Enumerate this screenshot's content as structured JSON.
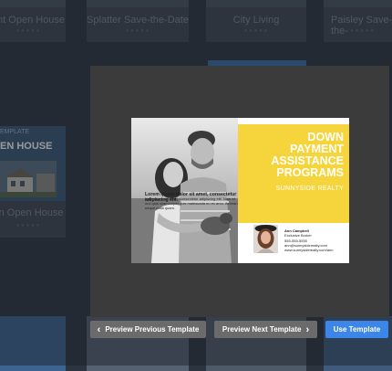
{
  "gallery": {
    "top_row": [
      {
        "title": "ant Open House",
        "stars": "★★★★★"
      },
      {
        "title": "Splatter Save-the-Date",
        "stars": "★★★★★"
      },
      {
        "title": "City Living",
        "stars": "★★★★★"
      },
      {
        "title": "Paisley Save-the-",
        "stars": "★★★★★"
      }
    ],
    "middle_card": {
      "badge": "EMPLATE",
      "overlay_text": "EN HOUSE",
      "title": "an Open House",
      "stars": "★★★★★"
    }
  },
  "preview": {
    "headline_lines": [
      "DOWN",
      "PAYMENT",
      "ASSISTANCE",
      "PROGRAMS"
    ],
    "company": "SUNNYSIDE REALTY",
    "lorem_bold": "Lorem ipsum dolor sit amet, consectetur adipiscing elit.",
    "lorem": "Nam at orci sit amet, consectetur adipiscing elit. Nam et orci quis ullamcorper quis malesuada eu ex arcu. Aenean neque nulla quam.",
    "agent": {
      "name": "Ann Campbell",
      "role": "Exclusive Broker",
      "phone": "555-555-5555",
      "email": "ann@sunnysiderealty.com",
      "web": "www.sunnysiderealty.com/ann"
    }
  },
  "modal": {
    "prev_label": "Preview Previous Template",
    "next_label": "Preview Next Template",
    "use_label": "Use Template",
    "prev_icon": "chevron-left-icon",
    "next_icon": "chevron-right-icon"
  },
  "colors": {
    "page_bg": "#2c3440",
    "modal_bg": "#3b3b3b",
    "accent_blue": "#3b86e8",
    "button_gray": "#6b6b6b",
    "headline_yellow": "#f6d43b"
  }
}
